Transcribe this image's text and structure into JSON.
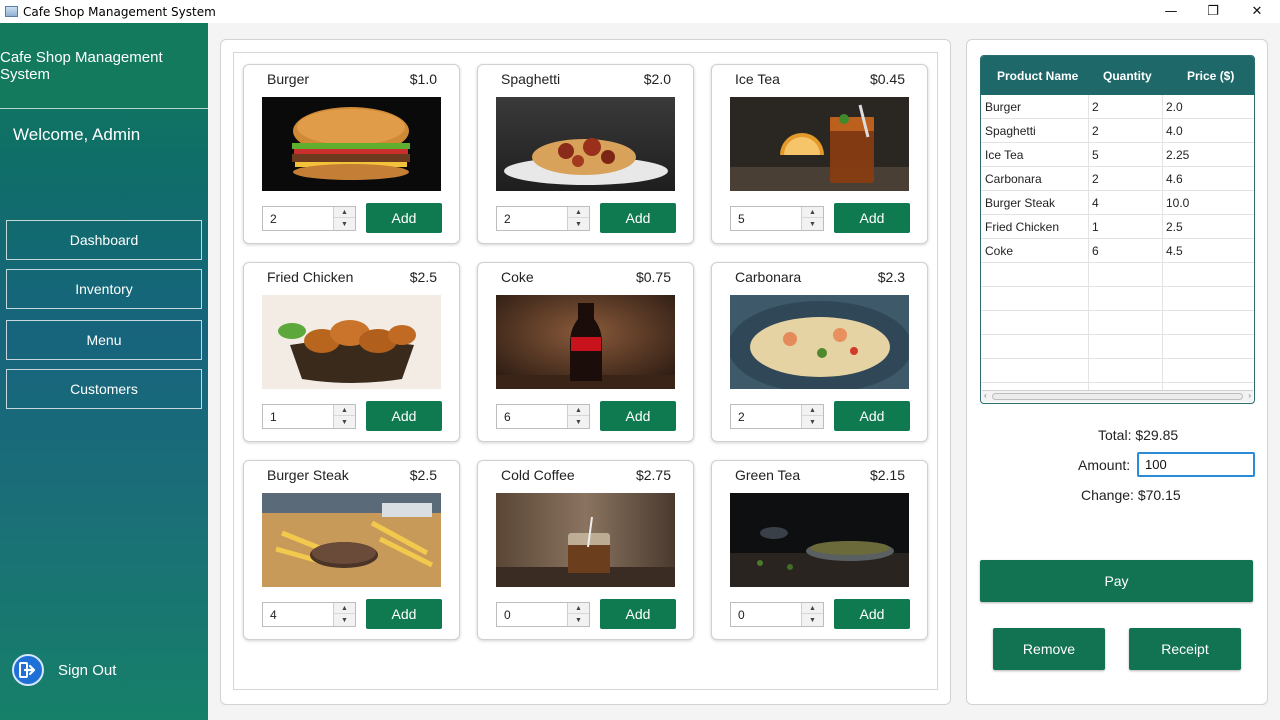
{
  "window": {
    "title": "Cafe Shop Management System",
    "minimize_glyph": "—",
    "maximize_glyph": "❐",
    "close_glyph": "✕"
  },
  "sidebar": {
    "title": "Cafe Shop Management System",
    "welcome": "Welcome, Admin",
    "nav": [
      "Dashboard",
      "Inventory",
      "Menu",
      "Customers"
    ],
    "signout": "Sign Out",
    "signout_icon": "sign-out-icon"
  },
  "menu": {
    "add_label": "Add",
    "products": [
      {
        "name": "Burger",
        "price": "$1.0",
        "qty": "2",
        "image": "burger"
      },
      {
        "name": "Spaghetti",
        "price": "$2.0",
        "qty": "2",
        "image": "spaghetti"
      },
      {
        "name": "Ice Tea",
        "price": "$0.45",
        "qty": "5",
        "image": "ice-tea"
      },
      {
        "name": "Fried Chicken",
        "price": "$2.5",
        "qty": "1",
        "image": "fried-chicken"
      },
      {
        "name": "Coke",
        "price": "$0.75",
        "qty": "6",
        "image": "coke"
      },
      {
        "name": "Carbonara",
        "price": "$2.3",
        "qty": "2",
        "image": "carbonara"
      },
      {
        "name": "Burger Steak",
        "price": "$2.5",
        "qty": "4",
        "image": "burger-steak"
      },
      {
        "name": "Cold Coffee",
        "price": "$2.75",
        "qty": "0",
        "image": "cold-coffee"
      },
      {
        "name": "Green Tea",
        "price": "$2.15",
        "qty": "0",
        "image": "green-tea"
      }
    ]
  },
  "order": {
    "columns": [
      "Product Name",
      "Quantity",
      "Price ($)"
    ],
    "rows": [
      [
        "Burger",
        "2",
        "2.0"
      ],
      [
        "Spaghetti",
        "2",
        "4.0"
      ],
      [
        "Ice Tea",
        "5",
        "2.25"
      ],
      [
        "Carbonara",
        "2",
        "4.6"
      ],
      [
        "Burger Steak",
        "4",
        "10.0"
      ],
      [
        "Fried Chicken",
        "1",
        "2.5"
      ],
      [
        "Coke",
        "6",
        "4.5"
      ]
    ],
    "total": "Total: $29.85",
    "amount_label": "Amount:",
    "amount_value": "100",
    "change": "Change: $70.15",
    "pay": "Pay",
    "remove": "Remove",
    "receipt": "Receipt"
  },
  "colors": {
    "primary_green": "#127352",
    "table_header": "#1f6869",
    "focus_border": "#2b8bd6"
  }
}
